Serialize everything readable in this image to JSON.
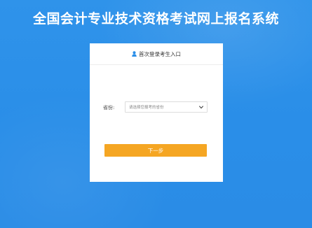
{
  "header": {
    "title": "全国会计专业技术资格考试网上报名系统"
  },
  "login_card": {
    "heading": "首次登录考生入口",
    "heading_icon": "user-icon",
    "province_label": "省份:",
    "province_select": {
      "selected_text": "请选择您报考的省份",
      "icon": "chevron-down-icon"
    },
    "next_button_label": "下一步"
  },
  "colors": {
    "background": "#2a8ee8",
    "card": "#ffffff",
    "accent_button": "#f5a623",
    "user_icon": "#2a8ee8"
  }
}
